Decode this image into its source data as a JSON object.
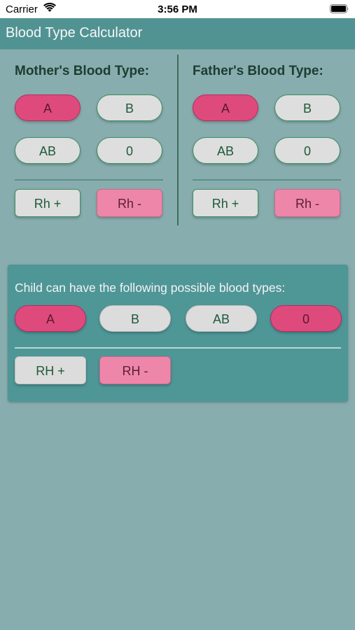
{
  "status_bar": {
    "carrier": "Carrier",
    "time": "3:56 PM"
  },
  "nav": {
    "title": "Blood Type Calculator"
  },
  "mother": {
    "title": "Mother's Blood Type:",
    "type_buttons": [
      "A",
      "B",
      "AB",
      "0"
    ],
    "rh_buttons": [
      "Rh  +",
      "Rh -"
    ]
  },
  "father": {
    "title": "Father's Blood Type:",
    "type_buttons": [
      "A",
      "B",
      "AB",
      "0"
    ],
    "rh_buttons": [
      "Rh +",
      "Rh -"
    ]
  },
  "result": {
    "title": "Child can have the following possible blood types:",
    "type_buttons": [
      "A",
      "B",
      "AB",
      "0"
    ],
    "rh_buttons": [
      "RH +",
      "RH -"
    ]
  },
  "colors": {
    "background": "#88adae",
    "nav_bar": "#519393",
    "selected": "#df4a7c",
    "rh_selected": "#ee86aa",
    "unselected": "#dedede"
  }
}
